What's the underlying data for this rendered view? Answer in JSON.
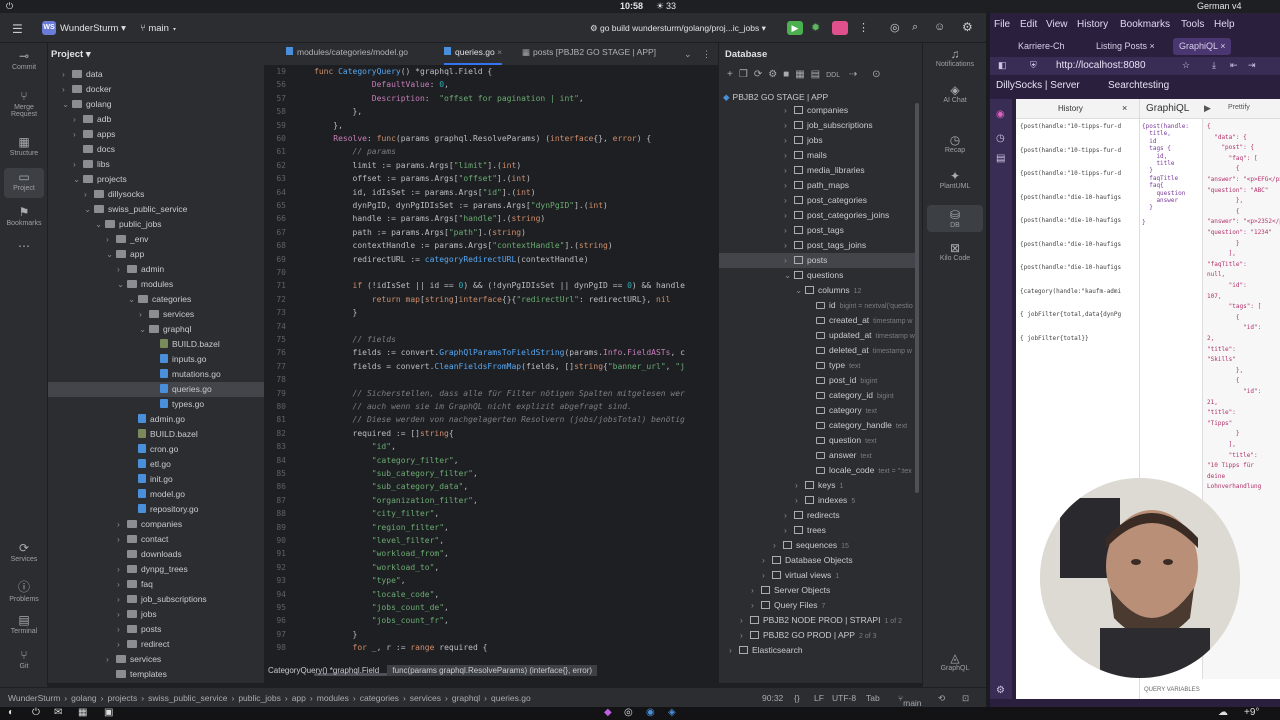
{
  "topbar": {
    "time": "10:58",
    "count": "33",
    "locale": "German",
    "version": "v4"
  },
  "ide": {
    "project_name": "WunderSturm",
    "project_badge": "WS",
    "branch": "main",
    "run_config": "go build wundersturm/golang/proj...ic_jobs"
  },
  "left_toolbar": [
    "Commit",
    "Merge Request",
    "Structure",
    "Project",
    "Bookmarks",
    "Services",
    "Problems",
    "Terminal",
    "Git"
  ],
  "project_panel": {
    "title": "Project",
    "tree": [
      {
        "label": "data",
        "indent": 0,
        "type": "folder",
        "arrow": "›"
      },
      {
        "label": "docker",
        "indent": 0,
        "type": "folder",
        "arrow": "›"
      },
      {
        "label": "golang",
        "indent": 0,
        "type": "folder",
        "arrow": "⌄"
      },
      {
        "label": "adb",
        "indent": 1,
        "type": "folder",
        "arrow": "›"
      },
      {
        "label": "apps",
        "indent": 1,
        "type": "folder",
        "arrow": "›"
      },
      {
        "label": "docs",
        "indent": 1,
        "type": "folder",
        "arrow": ""
      },
      {
        "label": "libs",
        "indent": 1,
        "type": "folder",
        "arrow": "›"
      },
      {
        "label": "projects",
        "indent": 1,
        "type": "folder",
        "arrow": "⌄"
      },
      {
        "label": "dillysocks",
        "indent": 2,
        "type": "folder",
        "arrow": "›"
      },
      {
        "label": "swiss_public_service",
        "indent": 2,
        "type": "folder",
        "arrow": "⌄"
      },
      {
        "label": "public_jobs",
        "indent": 3,
        "type": "folder",
        "arrow": "⌄"
      },
      {
        "label": "_env",
        "indent": 4,
        "type": "folder",
        "arrow": "›"
      },
      {
        "label": "app",
        "indent": 4,
        "type": "folder",
        "arrow": "⌄"
      },
      {
        "label": "admin",
        "indent": 5,
        "type": "folder",
        "arrow": "›"
      },
      {
        "label": "modules",
        "indent": 5,
        "type": "folder",
        "arrow": "⌄"
      },
      {
        "label": "categories",
        "indent": 6,
        "type": "folder",
        "arrow": "⌄"
      },
      {
        "label": "services",
        "indent": 7,
        "type": "folder",
        "arrow": "›"
      },
      {
        "label": "graphql",
        "indent": 7,
        "type": "folder",
        "arrow": "⌄"
      },
      {
        "label": "BUILD.bazel",
        "indent": 8,
        "type": "bazel",
        "arrow": ""
      },
      {
        "label": "inputs.go",
        "indent": 8,
        "type": "file",
        "arrow": ""
      },
      {
        "label": "mutations.go",
        "indent": 8,
        "type": "file",
        "arrow": ""
      },
      {
        "label": "queries.go",
        "indent": 8,
        "type": "file",
        "arrow": "",
        "selected": true
      },
      {
        "label": "types.go",
        "indent": 8,
        "type": "file",
        "arrow": ""
      },
      {
        "label": "admin.go",
        "indent": 6,
        "type": "file",
        "arrow": ""
      },
      {
        "label": "BUILD.bazel",
        "indent": 6,
        "type": "bazel",
        "arrow": ""
      },
      {
        "label": "cron.go",
        "indent": 6,
        "type": "file",
        "arrow": ""
      },
      {
        "label": "etl.go",
        "indent": 6,
        "type": "file",
        "arrow": ""
      },
      {
        "label": "init.go",
        "indent": 6,
        "type": "file",
        "arrow": ""
      },
      {
        "label": "model.go",
        "indent": 6,
        "type": "file",
        "arrow": ""
      },
      {
        "label": "repository.go",
        "indent": 6,
        "type": "file",
        "arrow": ""
      },
      {
        "label": "companies",
        "indent": 5,
        "type": "folder",
        "arrow": "›"
      },
      {
        "label": "contact",
        "indent": 5,
        "type": "folder",
        "arrow": "›"
      },
      {
        "label": "downloads",
        "indent": 5,
        "type": "folder",
        "arrow": ""
      },
      {
        "label": "dynpg_trees",
        "indent": 5,
        "type": "folder",
        "arrow": "›"
      },
      {
        "label": "faq",
        "indent": 5,
        "type": "folder",
        "arrow": "›"
      },
      {
        "label": "job_subscriptions",
        "indent": 5,
        "type": "folder",
        "arrow": "›"
      },
      {
        "label": "jobs",
        "indent": 5,
        "type": "folder",
        "arrow": "›"
      },
      {
        "label": "posts",
        "indent": 5,
        "type": "folder",
        "arrow": "›"
      },
      {
        "label": "redirect",
        "indent": 5,
        "type": "folder",
        "arrow": "›"
      },
      {
        "label": "services",
        "indent": 4,
        "type": "folder",
        "arrow": "›"
      },
      {
        "label": "templates",
        "indent": 4,
        "type": "folder",
        "arrow": ""
      }
    ]
  },
  "editor": {
    "tabs": [
      "modules/categories/model.go",
      "queries.go",
      "posts [PBJB2 GO STAGE | APP]"
    ],
    "lines": [
      {
        "n": "19",
        "html": "<span class='kw'>func</span> <span class='fn'>CategoryQuery</span>() *graphql.Field {"
      },
      {
        "n": "56",
        "html": "            <span class='fld'>DefaultValue</span>: <span class='num'>0</span>,"
      },
      {
        "n": "57",
        "html": "            <span class='fld'>Description</span>:  <span class='str'>\"offset for pagination | int\"</span>,"
      },
      {
        "n": "58",
        "html": "        },"
      },
      {
        "n": "59",
        "html": "    },"
      },
      {
        "n": "60",
        "html": "    <span class='fld'>Resolve</span>: <span class='kw'>func</span>(params graphql.ResolveParams) (<span class='kw'>interface</span>{}, <span class='kw'>error</span>) {"
      },
      {
        "n": "61",
        "html": "        <span class='cm'>// params</span>"
      },
      {
        "n": "62",
        "html": "        limit := params.Args[<span class='str'>\"limit\"</span>].(<span class='kw'>int</span>)"
      },
      {
        "n": "63",
        "html": "        offset := params.Args[<span class='str'>\"offset\"</span>].(<span class='kw'>int</span>)"
      },
      {
        "n": "64",
        "html": "        id, idIsSet := params.Args[<span class='str'>\"id\"</span>].(<span class='kw'>int</span>)"
      },
      {
        "n": "65",
        "html": "        dynPgID, dynPgIDIsSet := params.Args[<span class='str'>\"dynPgID\"</span>].(<span class='kw'>int</span>)"
      },
      {
        "n": "66",
        "html": "        handle := params.Args[<span class='str'>\"handle\"</span>].(<span class='kw'>string</span>)"
      },
      {
        "n": "67",
        "html": "        path := params.Args[<span class='str'>\"path\"</span>].(<span class='kw'>string</span>)"
      },
      {
        "n": "68",
        "html": "        contextHandle := params.Args[<span class='str'>\"contextHandle\"</span>].(<span class='kw'>string</span>)"
      },
      {
        "n": "69",
        "html": "        redirectURL := <span class='fn'>categoryRedirectURL</span>(contextHandle)"
      },
      {
        "n": "70",
        "html": ""
      },
      {
        "n": "71",
        "html": "        <span class='kw'>if</span> (!idIsSet || id == <span class='num'>0</span>) && (!dynPgIDIsSet || dynPgID == <span class='num'>0</span>) && handle"
      },
      {
        "n": "72",
        "html": "            <span class='kw'>return</span> <span class='kw'>map</span>[<span class='kw'>string</span>]<span class='kw'>interface</span>{}{<span class='str'>\"redirectUrl\"</span>: redirectURL}, <span class='kw'>nil</span>"
      },
      {
        "n": "73",
        "html": "        }"
      },
      {
        "n": "74",
        "html": ""
      },
      {
        "n": "75",
        "html": "        <span class='cm'>// fields</span>"
      },
      {
        "n": "76",
        "html": "        fields := convert.<span class='fn'>GraphQlParamsToFieldString</span>(params.<span class='fld'>Info</span>.<span class='fld'>FieldASTs</span>, c"
      },
      {
        "n": "77",
        "html": "        fields = convert.<span class='fn'>CleanFieldsFromMap</span>(fields, []<span class='kw'>string</span>{<span class='str'>\"banner_url\"</span>, <span class='str'>\"j</span>"
      },
      {
        "n": "78",
        "html": ""
      },
      {
        "n": "79",
        "html": "        <span class='cm'>// Sicherstellen, dass alle für Filter nötigen Spalten mitgelesen wer</span>"
      },
      {
        "n": "80",
        "html": "        <span class='cm'>// auch wenn sie im GraphQL nicht explizit abgefragt sind.</span>"
      },
      {
        "n": "81",
        "html": "        <span class='cm'>// Diese werden von nachgelagerten Resolvern (jobs/jobsTotal) benötig</span>"
      },
      {
        "n": "82",
        "html": "        required := []<span class='kw'>string</span>{"
      },
      {
        "n": "83",
        "html": "            <span class='str'>\"id\"</span>,"
      },
      {
        "n": "84",
        "html": "            <span class='str'>\"category_filter\"</span>,"
      },
      {
        "n": "85",
        "html": "            <span class='str'>\"sub_category_filter\"</span>,"
      },
      {
        "n": "86",
        "html": "            <span class='str'>\"sub_category_data\"</span>,"
      },
      {
        "n": "87",
        "html": "            <span class='str'>\"organization_filter\"</span>,"
      },
      {
        "n": "88",
        "html": "            <span class='str'>\"city_filter\"</span>,"
      },
      {
        "n": "89",
        "html": "            <span class='str'>\"region_filter\"</span>,"
      },
      {
        "n": "90",
        "html": "            <span class='str'>\"level_filter\"</span>,"
      },
      {
        "n": "91",
        "html": "            <span class='str'>\"workload_from\"</span>,"
      },
      {
        "n": "92",
        "html": "            <span class='str'>\"workload_to\"</span>,"
      },
      {
        "n": "93",
        "html": "            <span class='str'>\"type\"</span>,"
      },
      {
        "n": "94",
        "html": "            <span class='str'>\"locale_code\"</span>,"
      },
      {
        "n": "95",
        "html": "            <span class='str'>\"jobs_count_de\"</span>,"
      },
      {
        "n": "96",
        "html": "            <span class='str'>\"jobs_count_fr\"</span>,"
      },
      {
        "n": "97",
        "html": "        }"
      },
      {
        "n": "98",
        "html": "        <span class='kw'>for</span> _, r := <span class='kw'>range</span> required {"
      }
    ],
    "hint": "CategoryQuery() *graphql.Field",
    "hint_sig": "func(params graphql.ResolveParams) (interface{}, error)"
  },
  "db_panel": {
    "title": "Database",
    "datasource": "PBJB2 GO STAGE | APP",
    "rows": [
      {
        "label": "companies",
        "indent": 5,
        "kind": "table",
        "arrow": "›",
        "meta": ""
      },
      {
        "label": "job_subscriptions",
        "indent": 5,
        "kind": "table",
        "arrow": "›",
        "meta": ""
      },
      {
        "label": "jobs",
        "indent": 5,
        "kind": "table",
        "arrow": "›",
        "meta": ""
      },
      {
        "label": "mails",
        "indent": 5,
        "kind": "table",
        "arrow": "›",
        "meta": ""
      },
      {
        "label": "media_libraries",
        "indent": 5,
        "kind": "table",
        "arrow": "›",
        "meta": ""
      },
      {
        "label": "path_maps",
        "indent": 5,
        "kind": "table",
        "arrow": "›",
        "meta": ""
      },
      {
        "label": "post_categories",
        "indent": 5,
        "kind": "table",
        "arrow": "›",
        "meta": ""
      },
      {
        "label": "post_categories_joins",
        "indent": 5,
        "kind": "table",
        "arrow": "›",
        "meta": ""
      },
      {
        "label": "post_tags",
        "indent": 5,
        "kind": "table",
        "arrow": "›",
        "meta": ""
      },
      {
        "label": "post_tags_joins",
        "indent": 5,
        "kind": "table",
        "arrow": "›",
        "meta": ""
      },
      {
        "label": "posts",
        "indent": 5,
        "kind": "table",
        "arrow": "›",
        "meta": "",
        "selected": true
      },
      {
        "label": "questions",
        "indent": 5,
        "kind": "table",
        "arrow": "⌄",
        "meta": ""
      },
      {
        "label": "columns",
        "indent": 6,
        "kind": "folder",
        "arrow": "⌄",
        "meta": "12"
      },
      {
        "label": "id",
        "indent": 7,
        "kind": "col",
        "arrow": "",
        "meta": "bigint = nextval('questio"
      },
      {
        "label": "created_at",
        "indent": 7,
        "kind": "col",
        "arrow": "",
        "meta": "timestamp w"
      },
      {
        "label": "updated_at",
        "indent": 7,
        "kind": "col",
        "arrow": "",
        "meta": "timestamp w"
      },
      {
        "label": "deleted_at",
        "indent": 7,
        "kind": "col",
        "arrow": "",
        "meta": "timestamp w"
      },
      {
        "label": "type",
        "indent": 7,
        "kind": "col",
        "arrow": "",
        "meta": "text"
      },
      {
        "label": "post_id",
        "indent": 7,
        "kind": "col",
        "arrow": "",
        "meta": "bigint"
      },
      {
        "label": "category_id",
        "indent": 7,
        "kind": "col",
        "arrow": "",
        "meta": "bigint"
      },
      {
        "label": "category",
        "indent": 7,
        "kind": "col",
        "arrow": "",
        "meta": "text"
      },
      {
        "label": "category_handle",
        "indent": 7,
        "kind": "col",
        "arrow": "",
        "meta": "text"
      },
      {
        "label": "question",
        "indent": 7,
        "kind": "col",
        "arrow": "",
        "meta": "text"
      },
      {
        "label": "answer",
        "indent": 7,
        "kind": "col",
        "arrow": "",
        "meta": "text"
      },
      {
        "label": "locale_code",
        "indent": 7,
        "kind": "col",
        "arrow": "",
        "meta": "text = '':tex"
      },
      {
        "label": "keys",
        "indent": 6,
        "kind": "folder",
        "arrow": "›",
        "meta": "1"
      },
      {
        "label": "indexes",
        "indent": 6,
        "kind": "folder",
        "arrow": "›",
        "meta": "5"
      },
      {
        "label": "redirects",
        "indent": 5,
        "kind": "table",
        "arrow": "›",
        "meta": ""
      },
      {
        "label": "trees",
        "indent": 5,
        "kind": "table",
        "arrow": "›",
        "meta": ""
      },
      {
        "label": "sequences",
        "indent": 4,
        "kind": "folder",
        "arrow": "›",
        "meta": "15"
      },
      {
        "label": "Database Objects",
        "indent": 3,
        "kind": "folder",
        "arrow": "›",
        "meta": ""
      },
      {
        "label": "virtual views",
        "indent": 3,
        "kind": "folder",
        "arrow": "›",
        "meta": "1"
      },
      {
        "label": "Server Objects",
        "indent": 2,
        "kind": "folder",
        "arrow": "›",
        "meta": ""
      },
      {
        "label": "Query Files",
        "indent": 2,
        "kind": "folder",
        "arrow": "›",
        "meta": "7"
      },
      {
        "label": "PBJB2 NODE PROD | STRAPI",
        "indent": 1,
        "kind": "ds",
        "arrow": "›",
        "meta": "1 of 2"
      },
      {
        "label": "PBJB2 GO PROD | APP",
        "indent": 1,
        "kind": "ds",
        "arrow": "›",
        "meta": "2 of 3"
      },
      {
        "label": "Elasticsearch",
        "indent": 0,
        "kind": "ds",
        "arrow": "›",
        "meta": ""
      }
    ]
  },
  "right_toolbar": [
    "Notifications",
    "AI Chat",
    "Recap",
    "PlantUML",
    "DB",
    "Kilo Code",
    "GraphQL"
  ],
  "statusbar": {
    "breadcrumb": [
      "WunderSturm",
      "golang",
      "projects",
      "swiss_public_service",
      "public_jobs",
      "app",
      "modules",
      "categories",
      "services",
      "graphql",
      "queries.go"
    ],
    "position": "90:32",
    "line_ending": "LF",
    "encoding": "UTF-8",
    "indent": "Tab",
    "branch": "main"
  },
  "browser": {
    "menu": [
      "File",
      "Edit",
      "View",
      "History",
      "Bookmarks",
      "Tools",
      "Help"
    ],
    "tabs": [
      "Karriere-Ch",
      "Listing Posts",
      "GraphiQL"
    ],
    "url": "http://localhost:8080",
    "bookmarks": [
      "DillySocks | Server",
      "Searchtesting"
    ],
    "graphiql_title": "GraphiQL",
    "history_title": "History",
    "prettify": "Prettify",
    "history_items": [
      "{post(handle:\"10-tipps-fur-d",
      "{post(handle:\"10-tipps-fur-d",
      "{post(handle:\"10-tipps-fur-d",
      "{post(handle:\"die-10-haufigs",
      "{post(handle:\"die-10-haufigs",
      "{post(handle:\"die-10-haufigs",
      "{post(handle:\"die-10-haufigs",
      "{category(handle:\"kaufm-admi",
      "{ jobFilter{total,data{dynPg",
      "{ jobFilter{total}}"
    ],
    "query_lines": [
      "{post(handle:",
      "  title,",
      "  id",
      "  tags {",
      "    id,",
      "    title",
      "  }",
      "  faqTitle",
      "  faq{",
      "    question",
      "    answer",
      "  }",
      "",
      "}"
    ],
    "result_lines": [
      "{",
      "  \"data\": {",
      "    \"post\": {",
      "      \"faq\": [",
      "        {",
      "\"answer\": \"<p>EFG</p>\",",
      "\"question\": \"ABC\"",
      "        },",
      "        {",
      "\"answer\": \"<p>2352</p>\",",
      "\"question\": \"1234\"",
      "        }",
      "      ],",
      "\"faqTitle\":",
      "null,",
      "      \"id\":",
      "107,",
      "      \"tags\": [",
      "        {",
      "          \"id\":",
      "2,",
      "\"title\":",
      "\"Skills\"",
      "        },",
      "        {",
      "          \"id\":",
      "21,",
      "\"title\":",
      "\"Tipps\"",
      "        }",
      "      ],",
      "      \"title\":",
      "\"10 Tipps für",
      "deine",
      "Lohnverhandlung"
    ],
    "query_vars": "QUERY VARIABLES"
  }
}
